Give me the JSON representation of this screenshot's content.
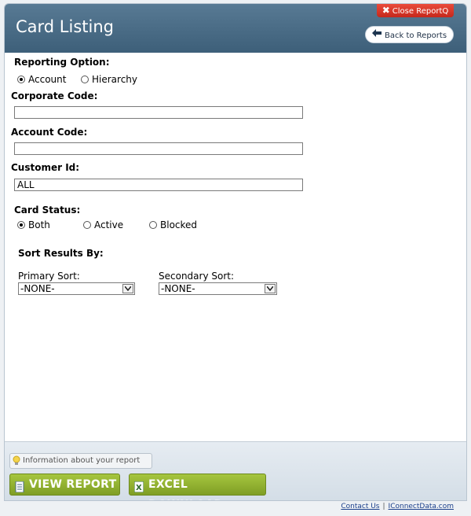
{
  "header": {
    "title": "Card Listing",
    "close_label": "Close ReportQ",
    "back_label": "Back to Reports"
  },
  "reporting_option": {
    "label": "Reporting Option:",
    "options": [
      "Account",
      "Hierarchy"
    ],
    "selected": "Account"
  },
  "corporate_code": {
    "label": "Corporate Code:",
    "value": ""
  },
  "account_code": {
    "label": "Account Code:",
    "value": ""
  },
  "customer_id": {
    "label": "Customer Id:",
    "value": "ALL"
  },
  "card_status": {
    "label": "Card Status:",
    "options": [
      "Both",
      "Active",
      "Blocked"
    ],
    "selected": "Both"
  },
  "sort": {
    "label": "Sort Results By:",
    "primary": {
      "label": "Primary Sort:",
      "value": "-NONE-"
    },
    "secondary": {
      "label": "Secondary Sort:",
      "value": "-NONE-"
    }
  },
  "footer": {
    "info_label": "Information about your report",
    "view_label": "VIEW REPORT",
    "excel_label": "EXCEL DOWNLOAD"
  },
  "links": {
    "contact": "Contact Us",
    "separator": "|",
    "site": "IConnectData.com"
  },
  "colors": {
    "header": "#4a6d87",
    "close": "#d8362a",
    "action": "#93b330"
  }
}
